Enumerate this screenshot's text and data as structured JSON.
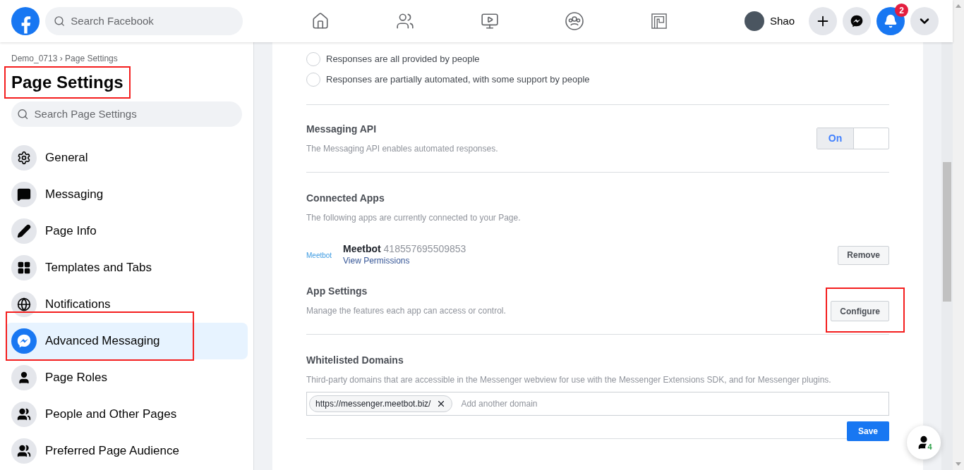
{
  "topbar": {
    "search": {
      "placeholder": "Search Facebook"
    },
    "nav": [
      {
        "selected": false
      },
      {
        "selected": false
      },
      {
        "selected": false
      },
      {
        "selected": false
      },
      {
        "selected": false
      }
    ],
    "profile": {
      "name": "Shao"
    },
    "notifications": {
      "count": "2"
    }
  },
  "sidebar": {
    "breadcrumb": "Demo_0713 › Page Settings",
    "title": "Page Settings",
    "search": {
      "placeholder": "Search Page Settings"
    },
    "items": [
      {
        "label": "General",
        "selected": false
      },
      {
        "label": "Messaging",
        "selected": false
      },
      {
        "label": "Page Info",
        "selected": false
      },
      {
        "label": "Templates and Tabs",
        "selected": false
      },
      {
        "label": "Notifications",
        "selected": false
      },
      {
        "label": "Advanced Messaging",
        "selected": true
      },
      {
        "label": "Page Roles",
        "selected": false
      },
      {
        "label": "People and Other Pages",
        "selected": false
      },
      {
        "label": "Preferred Page Audience",
        "selected": false
      }
    ]
  },
  "main": {
    "response_options": [
      {
        "label": "Responses are all provided by people",
        "selected": false
      },
      {
        "label": "Responses are partially automated, with some support by people",
        "selected": false
      }
    ],
    "messaging_api": {
      "title": "Messaging API",
      "description": "The Messaging API enables automated responses.",
      "toggle_label": "On",
      "on": true
    },
    "connected_apps": {
      "title": "Connected Apps",
      "description": "The following apps are currently connected to your Page.",
      "apps": [
        {
          "logo": "Meetbot",
          "name": "Meetbot",
          "id": "418557695509853",
          "link": "View Permissions",
          "button": "Remove"
        }
      ]
    },
    "app_settings": {
      "title": "App Settings",
      "description": "Manage the features each app can access or control.",
      "button": "Configure"
    },
    "whitelisted_domains": {
      "title": "Whitelisted Domains",
      "description": "Third-party domains that are accessible in the Messenger webview for use with the Messenger Extensions SDK, and for Messenger plugins.",
      "domains": [
        "https://messenger.meetbot.biz/"
      ],
      "placeholder": "Add another domain",
      "button": "Save"
    }
  },
  "chat_fab": {
    "count": "4"
  }
}
